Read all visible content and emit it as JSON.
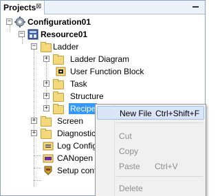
{
  "panel": {
    "tab_label": "Projects",
    "tab_close_glyph": "⊠"
  },
  "tree": {
    "configuration": "Configuration01",
    "resource": "Resource01",
    "ladder": "Ladder",
    "ladder_diagram": "Ladder Diagram",
    "user_function_block": "User Function Block",
    "task": "Task",
    "structure": "Structure",
    "recipe": "Recipe",
    "screen": "Screen",
    "diagnostic": "Diagnostic",
    "log_config": "Log Configu",
    "canopen": "CANopen",
    "setup_config": "Setup confi",
    "expand_glyph": "+",
    "collapse_glyph": "−"
  },
  "context_menu": {
    "new_file": "New File",
    "new_file_shortcut": "Ctrl+Shift+F",
    "cut": "Cut",
    "copy": "Copy",
    "paste": "Paste",
    "paste_shortcut": "Ctrl+V",
    "delete": "Delete"
  },
  "colors": {
    "selection": "#3399ff",
    "folder": "#f4d97c",
    "menu_hover": "#d8e6f7"
  }
}
